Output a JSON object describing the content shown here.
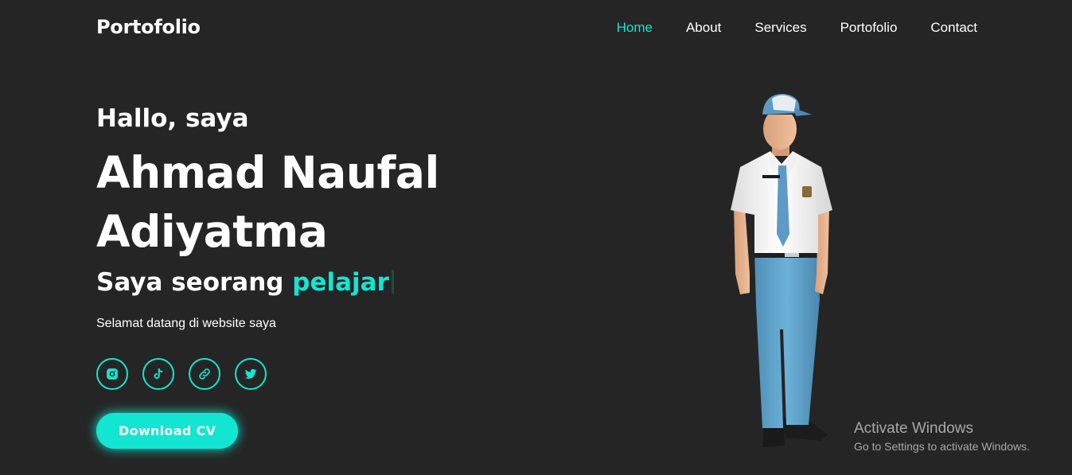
{
  "header": {
    "logo": "Portofolio",
    "nav": [
      {
        "label": "Home",
        "active": true
      },
      {
        "label": "About"
      },
      {
        "label": "Services"
      },
      {
        "label": "Portofolio"
      },
      {
        "label": "Contact"
      }
    ]
  },
  "hero": {
    "greeting": "Hallo, saya",
    "name_line1": "Ahmad Naufal",
    "name_line2": "Adiyatma",
    "role_prefix": "Saya seorang",
    "role_accent": "pelajar",
    "welcome": "Selamat datang di website saya",
    "socials": [
      "instagram-icon",
      "tiktok-icon",
      "link-icon",
      "twitter-icon"
    ],
    "cta_label": "Download CV"
  },
  "watermark": {
    "title": "Activate Windows",
    "subtitle": "Go to Settings to activate Windows."
  },
  "colors": {
    "accent": "#12e6d2",
    "background": "#252525",
    "text": "#ffffff"
  }
}
